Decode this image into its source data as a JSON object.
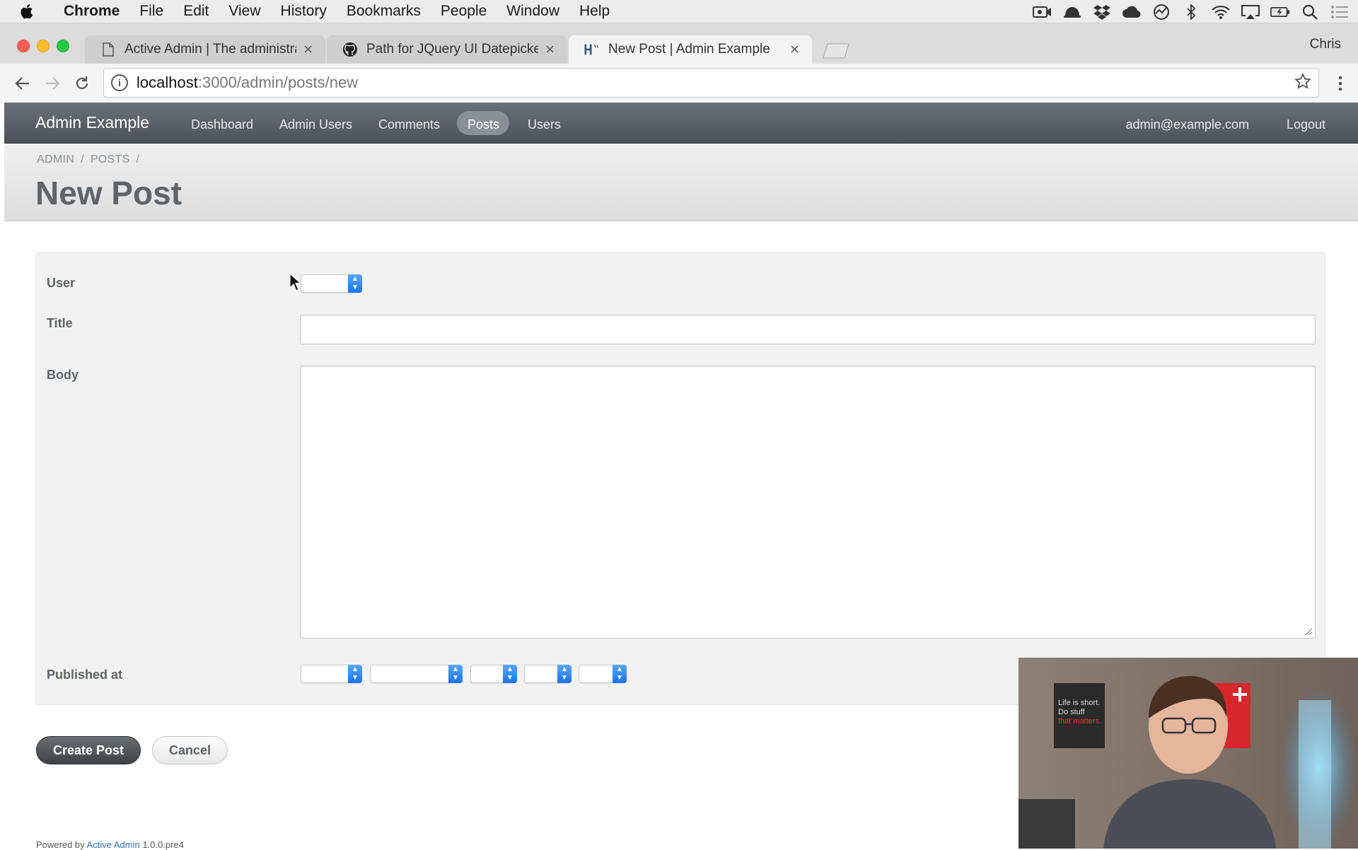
{
  "menubar": {
    "app": "Chrome",
    "items": [
      "File",
      "Edit",
      "View",
      "History",
      "Bookmarks",
      "People",
      "Window",
      "Help"
    ]
  },
  "browser": {
    "tabs": [
      {
        "title": "Active Admin | The administrat",
        "icon": "document-icon"
      },
      {
        "title": "Path for JQuery UI Datepicker",
        "icon": "github-icon"
      },
      {
        "title": "New Post | Admin Example",
        "icon": "heroku-icon"
      }
    ],
    "profile": "Chris",
    "url_host": "localhost",
    "url_path": ":3000/admin/posts/new"
  },
  "admin": {
    "site_title": "Admin Example",
    "nav": [
      "Dashboard",
      "Admin Users",
      "Comments",
      "Posts",
      "Users"
    ],
    "active_nav": "Posts",
    "current_user": "admin@example.com",
    "logout": "Logout",
    "breadcrumb": [
      "ADMIN",
      "POSTS"
    ],
    "page_title": "New Post"
  },
  "form": {
    "user_label": "User",
    "title_label": "Title",
    "body_label": "Body",
    "published_label": "Published at",
    "title_value": "",
    "body_value": "",
    "submit": "Create Post",
    "cancel": "Cancel"
  },
  "footer": {
    "prefix": "Powered by ",
    "link": "Active Admin",
    "version": " 1.0.0.pre4"
  },
  "webcam": {
    "poster_text_1": "Life is short.",
    "poster_text_2": "Do stuff",
    "poster_text_3": "that matters."
  },
  "colors": {
    "header_bg": "#51575d",
    "title_text": "#5e6469",
    "select_arrow": "#1a73e8"
  }
}
